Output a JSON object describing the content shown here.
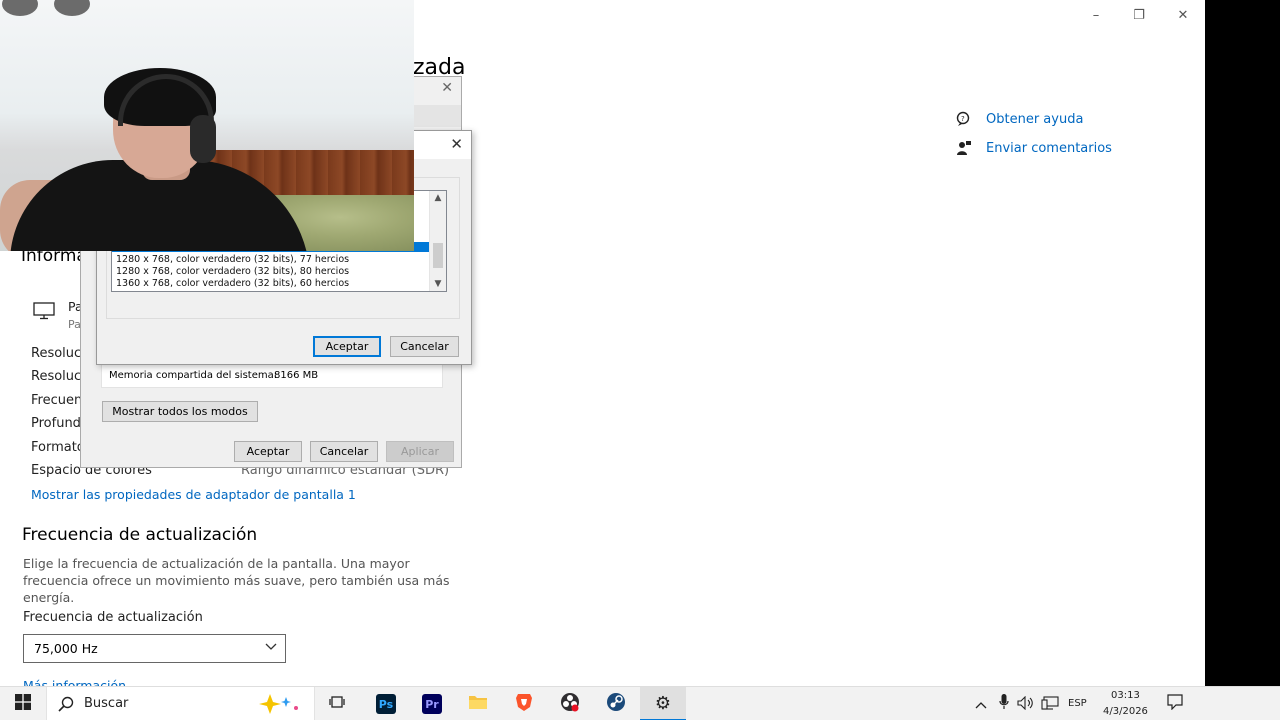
{
  "window": {
    "title_fragment": "zada",
    "controls": {
      "minimize": "–",
      "maximize": "❐",
      "close": "✕"
    }
  },
  "side_links": [
    {
      "label": "Obtener ayuda",
      "icon": "help-chat-icon"
    },
    {
      "label": "Enviar comentarios",
      "icon": "feedback-icon"
    }
  ],
  "info_section": {
    "title_fragment": "Informa",
    "display_name_fragment": "Pa",
    "display_sub_fragment": "Pa",
    "rows": [
      {
        "label": "Resoluci",
        "value": ""
      },
      {
        "label": "Resoluci",
        "value": ""
      },
      {
        "label": "Frecuenc",
        "value": ""
      },
      {
        "label": "Profundi",
        "value": ""
      },
      {
        "label": "Formato",
        "value": ""
      },
      {
        "label": "Espacio de colores",
        "value": "Rango dinámico estándar (SDR)"
      }
    ],
    "adapter_link": "Mostrar las propiedades de adaptador de pantalla 1"
  },
  "refresh_section": {
    "title": "Frecuencia de actualización",
    "description": "Elige la frecuencia de actualización de la pantalla. Una mayor frecuencia ofrece un movimiento más suave, pero también usa más energía.",
    "select_label": "Frecuencia de actualización",
    "select_value": "75,000 Hz",
    "more_info": "Más información"
  },
  "adapter_dialog": {
    "close": "✕",
    "memory_label": "Memoria compartida del sistema:",
    "memory_value": "8166 MB",
    "list_modes_button": "Mostrar todos los modos",
    "accept": "Aceptar",
    "cancel": "Cancelar",
    "apply": "Aplicar"
  },
  "modes_dialog": {
    "close": "✕",
    "modes": [
      "1280 x 768, color verdadero (32 bits), 77 hercios",
      "1280 x 768, color verdadero (32 bits), 80 hercios",
      "1360 x 768, color verdadero (32 bits), 60 hercios"
    ],
    "accept": "Aceptar",
    "cancel": "Cancelar"
  },
  "taskbar": {
    "search_placeholder": "Buscar",
    "apps": [
      {
        "name": "task-view",
        "label": ""
      },
      {
        "name": "photoshop",
        "label": "Ps",
        "color": "#001e36",
        "fg": "#31a8ff"
      },
      {
        "name": "premiere",
        "label": "Pr",
        "color": "#00005b",
        "fg": "#9999ff"
      },
      {
        "name": "file-explorer",
        "label": "",
        "color": "#f6c343"
      },
      {
        "name": "brave",
        "label": "",
        "color": "#fb542b"
      },
      {
        "name": "obs",
        "label": "",
        "color": "#302e31"
      },
      {
        "name": "steam",
        "label": "",
        "color": "#1b4a7a"
      },
      {
        "name": "settings",
        "label": "⚙"
      }
    ],
    "language": "ESP",
    "time": "03:13",
    "date": "4/3/2026"
  }
}
